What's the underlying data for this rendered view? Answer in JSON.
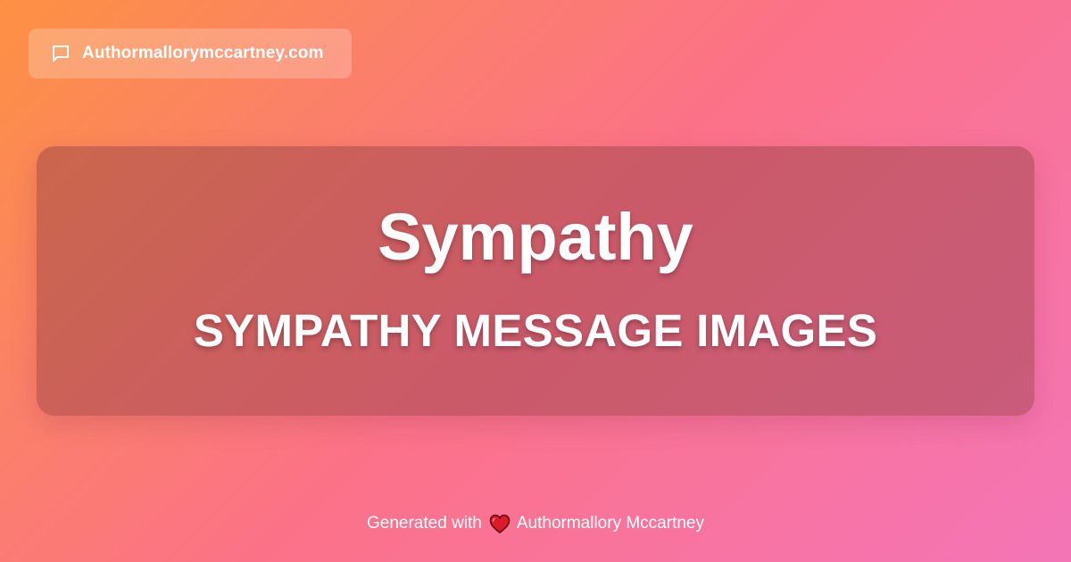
{
  "badge": {
    "icon": "speech-bubble-icon",
    "domain": "Authormallorymccartney.com"
  },
  "hero": {
    "title": "Sympathy",
    "subtitle": "SYMPATHY MESSAGE IMAGES"
  },
  "footer": {
    "prefix": "Generated with",
    "icon": "heart-icon",
    "author": "Authormallory Mccartney"
  },
  "colors": {
    "gradient_start": "#fd9143",
    "gradient_mid": "#fb7288",
    "gradient_end": "#f475b6",
    "card": "#96414679",
    "heart": "#e0182c"
  }
}
